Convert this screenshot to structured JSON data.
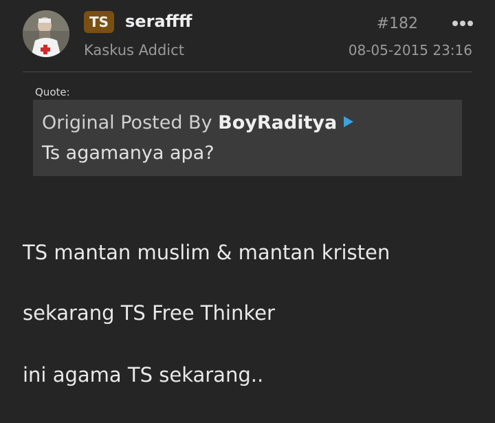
{
  "post": {
    "badge": "TS",
    "username": "seraffff",
    "rank": "Kaskus Addict",
    "number": "#182",
    "timestamp": "08-05-2015 23:16",
    "more_icon": "more-dots-icon"
  },
  "quote": {
    "label": "Quote:",
    "origin_prefix": "Original Posted By ",
    "author": "BoyRaditya",
    "goto_icon": "goto-arrow-icon",
    "text": "Ts agamanya apa?"
  },
  "body": {
    "lines": [
      "TS mantan muslim & mantan kristen",
      "sekarang TS Free Thinker",
      "ini agama TS sekarang.."
    ]
  },
  "colors": {
    "background": "#252525",
    "quote_background": "#3b3b3b",
    "badge": "#7a4f12",
    "link_arrow": "#3aa3e0",
    "muted_text": "#9a9a9a"
  }
}
